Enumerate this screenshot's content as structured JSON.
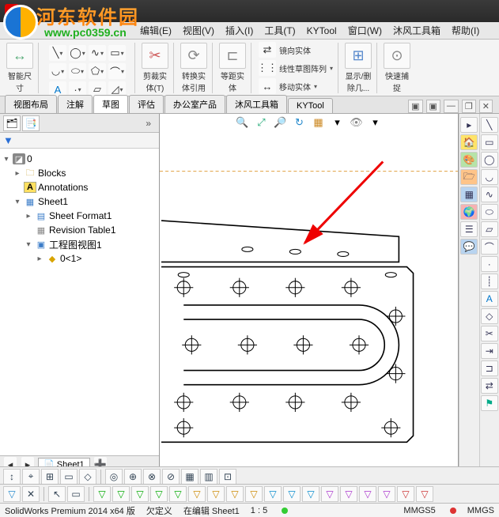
{
  "menu": {
    "edit": "编辑(E)",
    "view": "视图(V)",
    "insert": "插入(I)",
    "tools": "工具(T)",
    "kytool": "KYTool",
    "window": "窗口(W)",
    "mufeng": "沐风工具箱",
    "help": "帮助(I)"
  },
  "ribbon": {
    "smart_dim": "智能尺\n寸",
    "trim": "剪裁实\n体(T)",
    "convert": "转换实\n体引用",
    "offset": "等距实\n体",
    "mirror": "镜向实体",
    "linear": "线性草图阵列",
    "move": "移动实体",
    "showdel": "显示/删\n除几...",
    "snap": "快速捕\n捉"
  },
  "tabs": {
    "layout": "视图布局",
    "annot": "注解",
    "sketch": "草图",
    "eval": "评估",
    "office": "办公室产品",
    "mufeng": "沐风工具箱",
    "kytool": "KYTool"
  },
  "tree": {
    "root": "0",
    "blocks": "Blocks",
    "annotations": "Annotations",
    "sheet1": "Sheet1",
    "sheetfmt": "Sheet Format1",
    "revtbl": "Revision Table1",
    "view1": "工程图视图1",
    "part": "0<1>"
  },
  "sheet_tab": "Sheet1",
  "status": {
    "product": "SolidWorks Premium 2014 x64 版",
    "under": "欠定义",
    "editing": "在编辑 Sheet1",
    "scale": "1 : 5",
    "units": "MMGS5",
    "units2": "MMGS"
  }
}
